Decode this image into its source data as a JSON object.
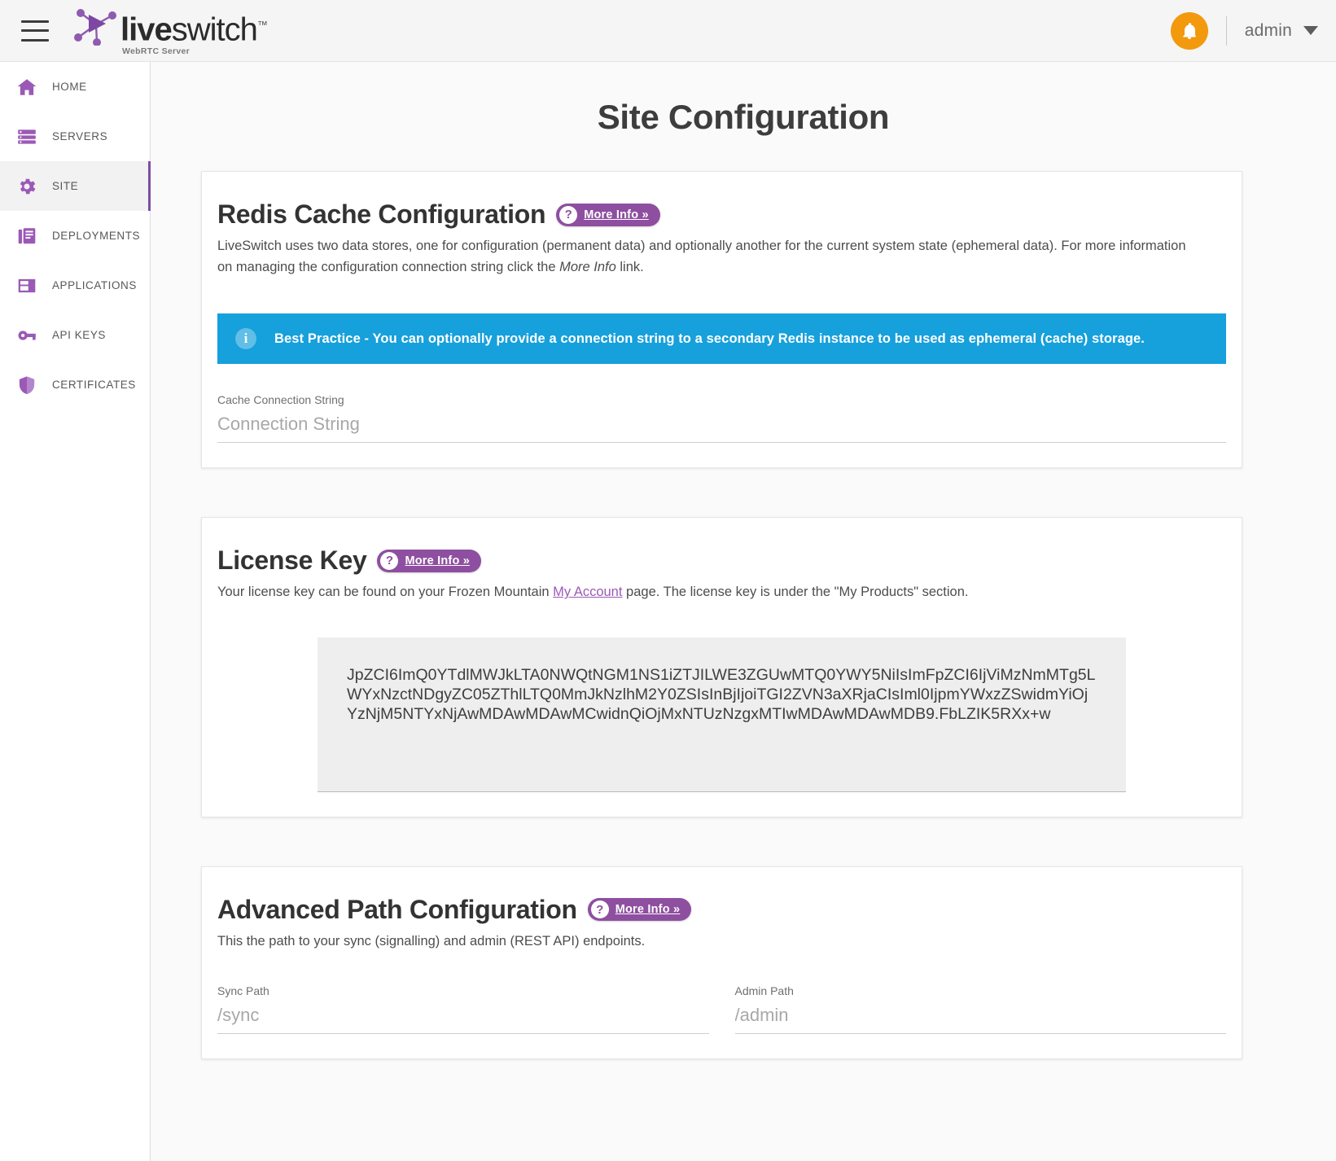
{
  "header": {
    "menu_icon": "hamburger-menu-icon",
    "logo_word_1": "live",
    "logo_word_2": "switch",
    "logo_tm": "™",
    "logo_subtitle": "WebRTC Server",
    "notification_icon": "bell-icon",
    "user_label": "admin",
    "user_caret_icon": "chevron-down-icon"
  },
  "sidebar": {
    "items": [
      {
        "label": "HOME",
        "icon": "home-icon",
        "active": false
      },
      {
        "label": "SERVERS",
        "icon": "servers-icon",
        "active": false
      },
      {
        "label": "SITE",
        "icon": "gear-icon",
        "active": true
      },
      {
        "label": "DEPLOYMENTS",
        "icon": "documents-icon",
        "active": false
      },
      {
        "label": "APPLICATIONS",
        "icon": "window-layout-icon",
        "active": false
      },
      {
        "label": "API KEYS",
        "icon": "key-icon",
        "active": false
      },
      {
        "label": "CERTIFICATES",
        "icon": "shield-icon",
        "active": false
      }
    ]
  },
  "page": {
    "title": "Site Configuration"
  },
  "redis": {
    "title": "Redis Cache Configuration",
    "more_info_label": "More Info »",
    "more_info_qmark": "?",
    "description_part1": "LiveSwitch uses two data stores, one for configuration (permanent data) and optionally another for the current system state (ephemeral data). For more information on managing the configuration connection string click the ",
    "description_italic": "More Info",
    "description_part2": " link.",
    "banner_icon": "info-icon",
    "banner_text": "Best Practice - You can optionally provide a connection string to a secondary Redis instance to be used as ephemeral (cache) storage.",
    "banner_color": "#16a0dc",
    "field_label": "Cache Connection String",
    "field_value": "",
    "field_placeholder": "Connection String"
  },
  "license": {
    "title": "License Key",
    "more_info_label": "More Info »",
    "more_info_qmark": "?",
    "description_part1": "Your license key can be found on your Frozen Mountain ",
    "description_link": "My Account",
    "description_part2": " page. The license key is under the \"My Products\" section.",
    "key_value": "JpZCI6ImQ0YTdlMWJkLTA0NWQtNGM1NS1iZTJILWE3ZGUwMTQ0YWY5NiIsImFpZCI6IjViMzNmMTg5LWYxNzctNDgyZC05ZThlLTQ0MmJkNzlhM2Y0ZSIsInBjIjoiTGI2ZVN3aXRjaCIsIml0IjpmYWxzZSwidmYiOjYzNjM5NTYxNjAwMDAwMDAwMCwidnQiOjMxNTUzNzgxMTIwMDAwMDAwMDB9.FbLZIK5RXx+w",
    "key_spellcheck_tail": "w"
  },
  "advanced": {
    "title": "Advanced Path Configuration",
    "more_info_label": "More Info »",
    "more_info_qmark": "?",
    "description": "This the path to your sync (signalling) and admin (REST API) endpoints.",
    "sync_label": "Sync Path",
    "sync_value": "",
    "sync_placeholder": "/sync",
    "admin_label": "Admin Path",
    "admin_value": "",
    "admin_placeholder": "/admin"
  },
  "colors": {
    "accent_purple": "#8e4fa0",
    "icon_purple": "#9b59b6",
    "info_blue": "#16a0dc",
    "bell_orange": "#f2990d"
  }
}
